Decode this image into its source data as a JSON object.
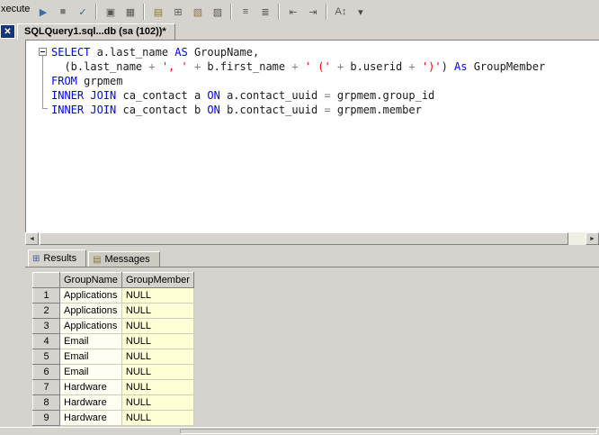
{
  "colors": {
    "chrome": "#d6d3ce",
    "editor_bg": "#ffffff",
    "kw": "#0000ff",
    "str": "#ff0000",
    "op": "#808080",
    "tab_close_bg": "#16367c",
    "cell_bg": "#fffef2",
    "null_cell_bg": "#ffffd6",
    "grid_line": "#cfccba"
  },
  "toolbar": {
    "partial_label": "xecute",
    "icons": [
      {
        "name": "debug-play-icon",
        "glyph": "▶",
        "color": "#3b6ea5"
      },
      {
        "name": "stop-icon",
        "glyph": "■",
        "color": "#7b7b7b"
      },
      {
        "name": "parse-check-icon",
        "glyph": "✓",
        "color": "#2e5e9e"
      },
      {
        "sep": true
      },
      {
        "name": "estimated-plan-icon",
        "glyph": "▣",
        "color": "#55584e"
      },
      {
        "name": "query-options-icon",
        "glyph": "▦",
        "color": "#55584e"
      },
      {
        "sep": true
      },
      {
        "name": "specify-template-values-icon",
        "glyph": "▤",
        "color": "#8a7a2f"
      },
      {
        "name": "design-query-icon",
        "glyph": "⊞",
        "color": "#55584e"
      },
      {
        "name": "include-actual-plan-icon",
        "glyph": "▧",
        "color": "#8a7a2f"
      },
      {
        "name": "client-statistics-icon",
        "glyph": "▨",
        "color": "#55584e"
      },
      {
        "sep": true
      },
      {
        "name": "results-to-text-icon",
        "glyph": "≡",
        "color": "#55584e"
      },
      {
        "name": "results-to-grid-icon",
        "glyph": "≣",
        "color": "#55584e"
      },
      {
        "sep": true
      },
      {
        "name": "outdent-icon",
        "glyph": "⇤",
        "color": "#55584e"
      },
      {
        "name": "indent-icon",
        "glyph": "⇥",
        "color": "#55584e"
      },
      {
        "sep": true
      },
      {
        "name": "sort-case-icon",
        "glyph": "A↕",
        "color": "#55584e"
      },
      {
        "name": "toolbar-overflow-chevron-icon",
        "glyph": "▾",
        "color": "#444444"
      }
    ]
  },
  "tab": {
    "close_glyph": "✕",
    "title": "SQLQuery1.sql...db (sa (102))*"
  },
  "editor": {
    "lines": [
      {
        "tokens": [
          {
            "t": "SELECT",
            "c": "kw"
          },
          {
            "t": " a.last_name ",
            "c": "id"
          },
          {
            "t": "AS",
            "c": "kw"
          },
          {
            "t": " GroupName,",
            "c": "id"
          }
        ]
      },
      {
        "tokens": [
          {
            "t": "  (b.last_name ",
            "c": "id"
          },
          {
            "t": "+ ",
            "c": "op"
          },
          {
            "t": "', '",
            "c": "str"
          },
          {
            "t": " ",
            "c": "id"
          },
          {
            "t": "+ ",
            "c": "op"
          },
          {
            "t": "b.first_name ",
            "c": "id"
          },
          {
            "t": "+ ",
            "c": "op"
          },
          {
            "t": "' ('",
            "c": "str"
          },
          {
            "t": " ",
            "c": "id"
          },
          {
            "t": "+ ",
            "c": "op"
          },
          {
            "t": "b.userid ",
            "c": "id"
          },
          {
            "t": "+ ",
            "c": "op"
          },
          {
            "t": "')'",
            "c": "str"
          },
          {
            "t": ") ",
            "c": "id"
          },
          {
            "t": "As",
            "c": "kw"
          },
          {
            "t": " GroupMember",
            "c": "id"
          }
        ]
      },
      {
        "tokens": [
          {
            "t": "FROM",
            "c": "kw"
          },
          {
            "t": " grpmem",
            "c": "id"
          }
        ]
      },
      {
        "tokens": [
          {
            "t": "INNER JOIN",
            "c": "kw"
          },
          {
            "t": " ca_contact a ",
            "c": "id"
          },
          {
            "t": "ON",
            "c": "kw"
          },
          {
            "t": " a.contact_uuid ",
            "c": "id"
          },
          {
            "t": "=",
            "c": "op"
          },
          {
            "t": " grpmem.group_id",
            "c": "id"
          }
        ]
      },
      {
        "tokens": [
          {
            "t": "INNER JOIN",
            "c": "kw"
          },
          {
            "t": " ca_contact b ",
            "c": "id"
          },
          {
            "t": "ON",
            "c": "kw"
          },
          {
            "t": " b.contact_uuid ",
            "c": "id"
          },
          {
            "t": "=",
            "c": "op"
          },
          {
            "t": " grpmem.member",
            "c": "id"
          }
        ]
      }
    ]
  },
  "scrollbar": {
    "left_glyph": "◄",
    "right_glyph": "►"
  },
  "results": {
    "active_tab": 0,
    "tabs": [
      {
        "label": "Results",
        "icon": "results-grid-icon",
        "glyph": "⊞",
        "icon_color": "#3b5e8e"
      },
      {
        "label": "Messages",
        "icon": "messages-icon",
        "glyph": "▤",
        "icon_color": "#8a7a2f"
      }
    ],
    "grid": {
      "columns": [
        "GroupName",
        "GroupMember"
      ],
      "rows": [
        {
          "n": "1",
          "values": [
            "Applications",
            "NULL"
          ]
        },
        {
          "n": "2",
          "values": [
            "Applications",
            "NULL"
          ]
        },
        {
          "n": "3",
          "values": [
            "Applications",
            "NULL"
          ]
        },
        {
          "n": "4",
          "values": [
            "Email",
            "NULL"
          ]
        },
        {
          "n": "5",
          "values": [
            "Email",
            "NULL"
          ]
        },
        {
          "n": "6",
          "values": [
            "Email",
            "NULL"
          ]
        },
        {
          "n": "7",
          "values": [
            "Hardware",
            "NULL"
          ]
        },
        {
          "n": "8",
          "values": [
            "Hardware",
            "NULL"
          ]
        },
        {
          "n": "9",
          "values": [
            "Hardware",
            "NULL"
          ]
        }
      ]
    }
  }
}
